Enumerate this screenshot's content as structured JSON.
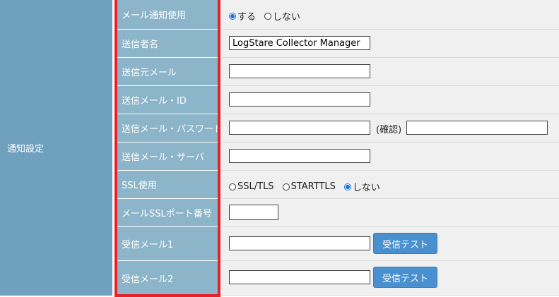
{
  "section_label": "通知設定",
  "labels": {
    "mail_notify": "メール通知使用",
    "sender_name": "送信者名",
    "sender_mail": "送信元メール",
    "sender_id": "送信メール・ID",
    "sender_password": "送信メール・パスワード",
    "sender_server": "送信メール・サーバ",
    "ssl_use": "SSL使用",
    "ssl_port": "メールSSLポート番号",
    "recv_mail1": "受信メール1",
    "recv_mail2": "受信メール2"
  },
  "mail_notify": {
    "options": [
      "する",
      "しない"
    ],
    "selected": "する"
  },
  "sender_name_value": "LogStare Collector Manager",
  "confirm_label": "(確認)",
  "ssl": {
    "options": [
      "SSL/TLS",
      "STARTTLS",
      "しない"
    ],
    "selected": "しない"
  },
  "recv_test_button": "受信テスト",
  "colors": {
    "section_bg": "#6fa0be",
    "label_bg": "#8cb5c9",
    "highlight_border": "#e8202a",
    "button_bg": "#4a90d0"
  }
}
